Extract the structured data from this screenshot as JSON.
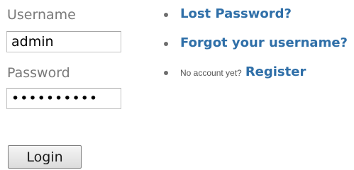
{
  "form": {
    "username_label": "Username",
    "username_value": "admin",
    "password_label": "Password",
    "password_value": "••••••••••",
    "login_button": "Login"
  },
  "links": {
    "lost_password": "Lost Password?",
    "forgot_username": "Forgot your username?",
    "no_account_text": "No account yet?",
    "register": "Register"
  },
  "colors": {
    "link": "#2f6fa8",
    "label": "#7a7a7a"
  }
}
